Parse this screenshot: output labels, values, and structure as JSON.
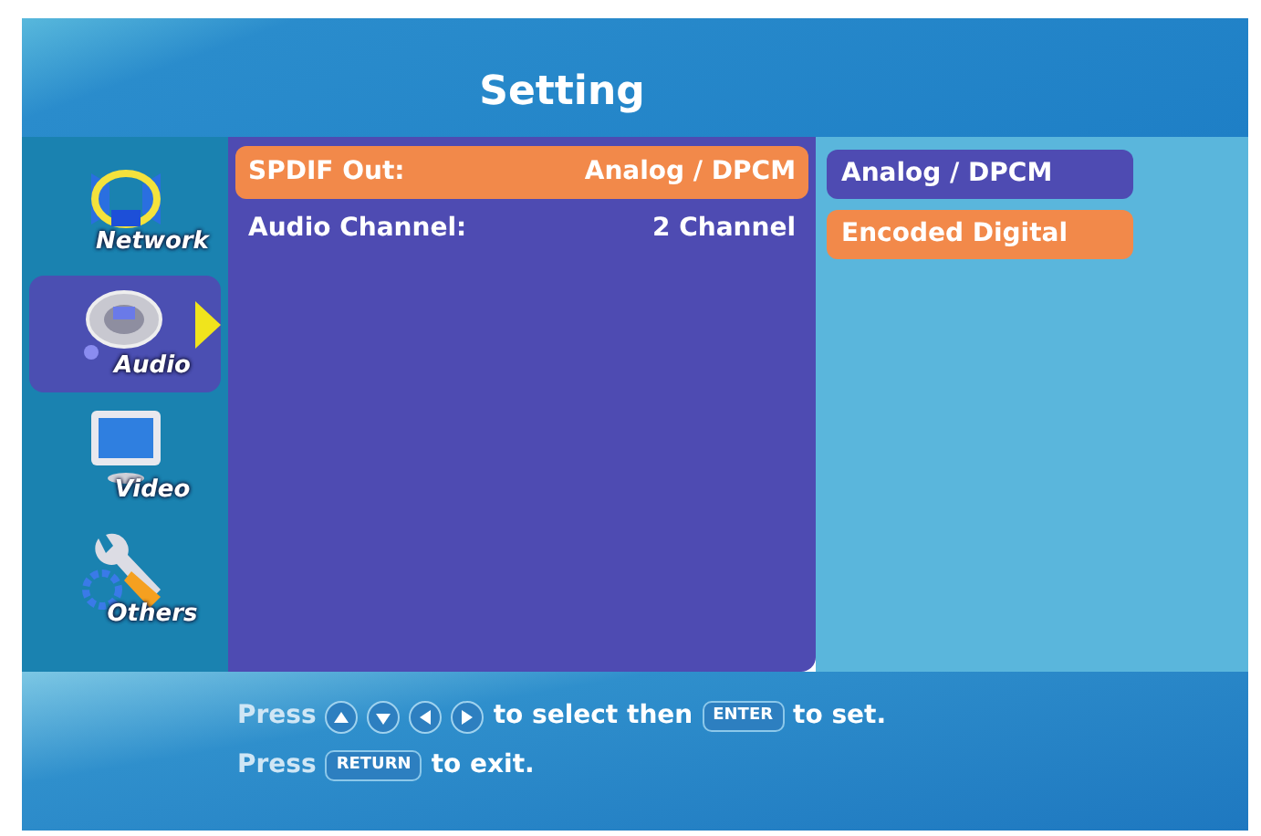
{
  "header": {
    "title": "Setting"
  },
  "sidebar": {
    "items": [
      {
        "label": "Network",
        "kind": "network",
        "selected": false
      },
      {
        "label": "Audio",
        "kind": "audio",
        "selected": true
      },
      {
        "label": "Video",
        "kind": "video",
        "selected": false
      },
      {
        "label": "Others",
        "kind": "others",
        "selected": false
      }
    ]
  },
  "settings": [
    {
      "label": "SPDIF Out:",
      "value": "Analog / DPCM",
      "focused": true
    },
    {
      "label": "Audio Channel:",
      "value": "2 Channel",
      "focused": false
    }
  ],
  "options": [
    {
      "label": "Analog / DPCM",
      "highlighted": false
    },
    {
      "label": "Encoded Digital",
      "highlighted": true
    }
  ],
  "footer": {
    "line_1": {
      "press": "Press",
      "select": "to select then",
      "key": "ENTER",
      "set": "to set."
    },
    "line_2": {
      "press": "Press",
      "key": "RETURN",
      "exit": "to exit."
    }
  }
}
